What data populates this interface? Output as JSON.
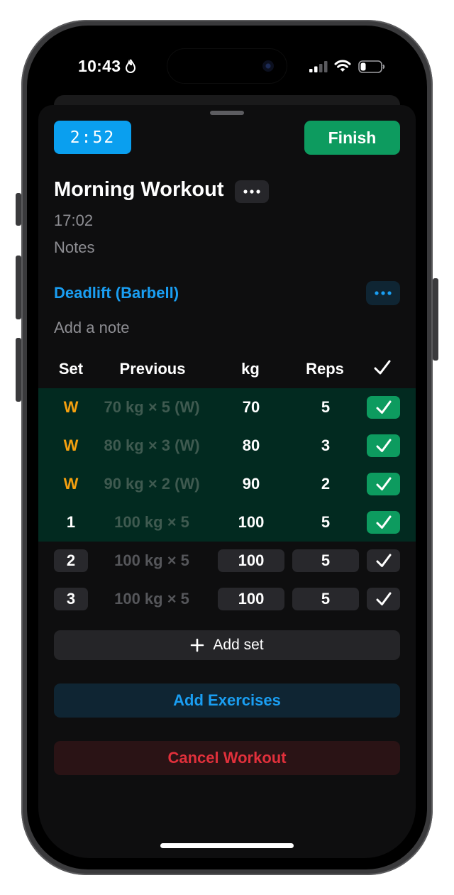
{
  "status_bar": {
    "time": "10:43"
  },
  "workout": {
    "timer": "2:52",
    "finish_label": "Finish",
    "title": "Morning Workout",
    "start_time": "17:02",
    "notes_placeholder": "Notes"
  },
  "exercise": {
    "name": "Deadlift (Barbell)",
    "note_placeholder": "Add a note",
    "columns": {
      "set": "Set",
      "previous": "Previous",
      "kg": "kg",
      "reps": "Reps"
    },
    "sets": [
      {
        "set": "W",
        "previous": "70 kg × 5 (W)",
        "kg": "70",
        "reps": "5",
        "done": true
      },
      {
        "set": "W",
        "previous": "80 kg × 3 (W)",
        "kg": "80",
        "reps": "3",
        "done": true
      },
      {
        "set": "W",
        "previous": "90 kg × 2 (W)",
        "kg": "90",
        "reps": "2",
        "done": true
      },
      {
        "set": "1",
        "previous": "100 kg × 5",
        "kg": "100",
        "reps": "5",
        "done": true
      },
      {
        "set": "2",
        "previous": "100 kg × 5",
        "kg": "100",
        "reps": "5",
        "done": false
      },
      {
        "set": "3",
        "previous": "100 kg × 5",
        "kg": "100",
        "reps": "5",
        "done": false
      }
    ],
    "add_set_label": "Add set"
  },
  "actions": {
    "add_exercises": "Add Exercises",
    "cancel_workout": "Cancel Workout"
  },
  "colors": {
    "timer_blue": "#0a9fef",
    "finish_green": "#0d9b5f",
    "warmup_orange": "#f5a00f",
    "link_blue": "#1a9ef2",
    "cancel_red": "#e0303b"
  }
}
